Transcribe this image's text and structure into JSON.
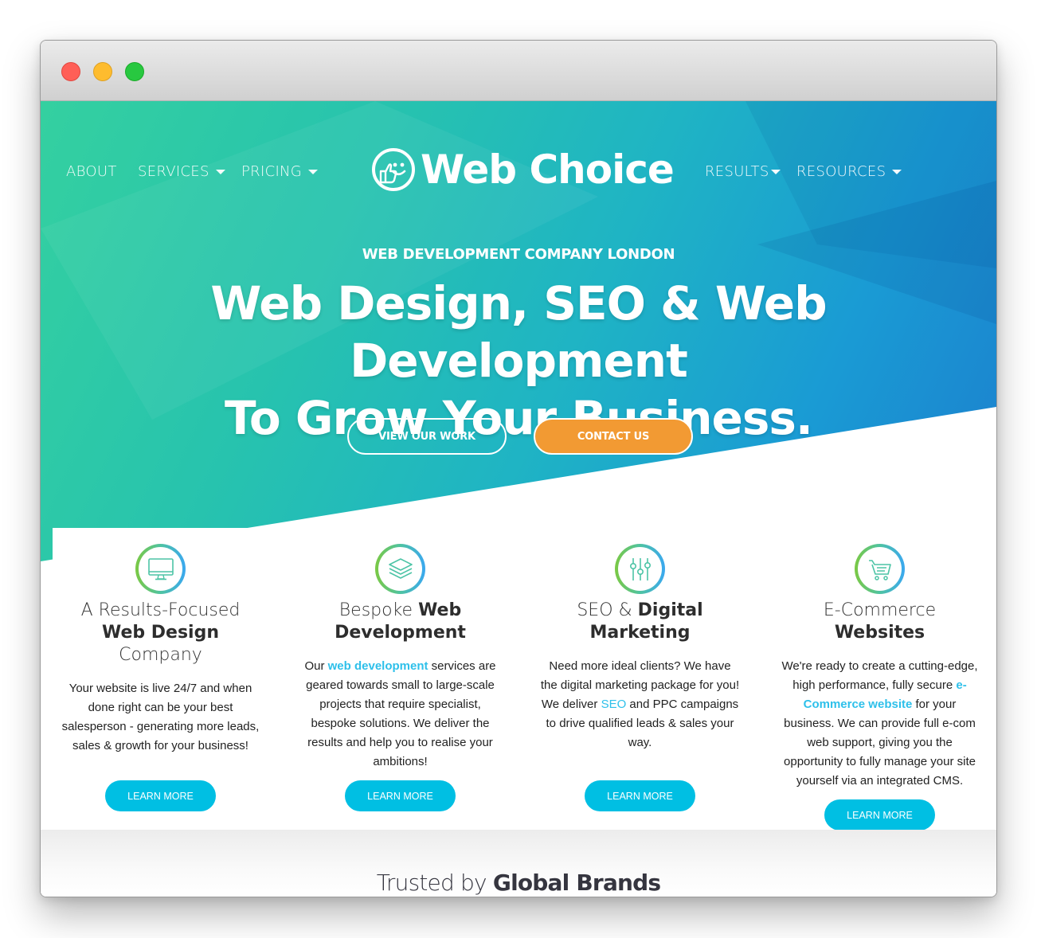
{
  "window": {
    "controls": [
      "close",
      "minimize",
      "maximize"
    ]
  },
  "nav": {
    "left": [
      {
        "label": "ABOUT",
        "dropdown": false
      },
      {
        "label": "SERVICES",
        "dropdown": true
      },
      {
        "label": "PRICING",
        "dropdown": true
      }
    ],
    "logo_text": "Web Choice",
    "logo_icon": "thumbs-up-smiley-icon",
    "right": [
      {
        "label": "RESULTS",
        "dropdown": true
      },
      {
        "label": "RESOURCES",
        "dropdown": true
      }
    ]
  },
  "hero": {
    "eyebrow": "WEB DEVELOPMENT COMPANY LONDON",
    "headline_line1": "Web Design, SEO & Web Development",
    "headline_line2": "To Grow Your Business.",
    "buttons": {
      "view_work": "VIEW OUR WORK",
      "contact": "CONTACT US"
    },
    "colors": {
      "gradient_start": "#34d0a0",
      "gradient_end": "#1c7fce",
      "contact_button": "#f29a33"
    }
  },
  "services": [
    {
      "icon": "monitor-icon",
      "title_light_1": "A Results-Focused",
      "title_bold": "Web Design",
      "title_light_2": "Company",
      "body": "Your website is live 24/7 and when done right can be your best salesperson - generating more leads, sales & growth for your business!",
      "button": "LEARN MORE"
    },
    {
      "icon": "layers-icon",
      "title_light_1": "Bespoke",
      "title_bold_1": "Web",
      "title_bold_2": "Development",
      "body_pre": "Our ",
      "body_link": "web development",
      "body_post": " services are geared towards small to large-scale projects that require specialist, bespoke solutions. We deliver the results and help you to realise your ambitions!",
      "button": "LEARN MORE"
    },
    {
      "icon": "sliders-icon",
      "title_light_1": "SEO &",
      "title_bold_1": "Digital",
      "title_bold_2": "Marketing",
      "body_pre": "Need more ideal clients? We have the digital marketing package for you! We deliver ",
      "body_link": "SEO",
      "body_post": " and PPC campaigns to drive qualified leads & sales your way.",
      "button": "LEARN MORE"
    },
    {
      "icon": "shopping-cart-icon",
      "title_light_1": "E-Commerce",
      "title_bold_1": "Websites",
      "body_pre": "We're ready to create a cutting-edge, high performance, fully secure ",
      "body_link": "e-Commerce website",
      "body_post": " for your business. We can provide full e-com web support, giving you the opportunity to fully manage your site yourself via an integrated CMS.",
      "button": "LEARN MORE"
    }
  ],
  "brands": {
    "title_light": "Trusted by",
    "title_bold": "Global Brands"
  },
  "colors": {
    "learn_more_button": "#00bfe3",
    "link": "#2ec0ea",
    "heading_text": "#2d2d2d"
  }
}
